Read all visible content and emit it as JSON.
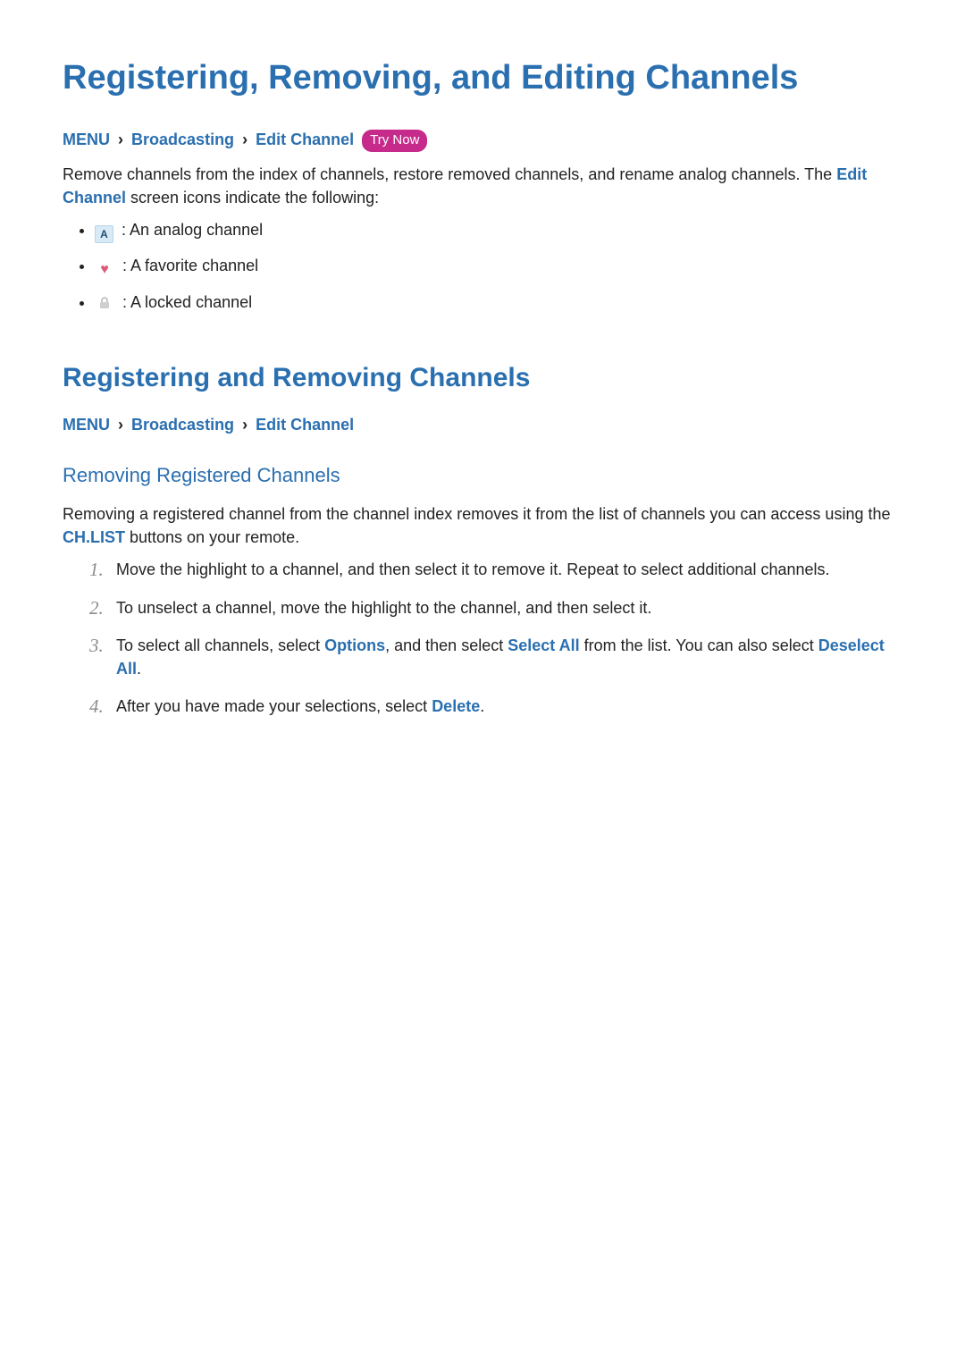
{
  "title": "Registering, Removing, and Editing Channels",
  "breadcrumb1": {
    "menu": "MENU",
    "broadcasting": "Broadcasting",
    "edit_channel": "Edit Channel",
    "try_now": "Try Now"
  },
  "intro": {
    "line1": "Remove channels from the index of channels, restore removed channels, and rename analog channels. The ",
    "edit_channel": "Edit Channel",
    "line2": " screen icons indicate the following:"
  },
  "icons": {
    "analog_letter": "A",
    "analog_label": " : An analog channel",
    "heart_label": " : A favorite channel",
    "lock_label": " : A locked channel"
  },
  "section2": {
    "heading": "Registering and Removing Channels",
    "breadcrumb": {
      "menu": "MENU",
      "broadcasting": "Broadcasting",
      "edit_channel": "Edit Channel"
    }
  },
  "subsection": {
    "heading": "Removing Registered Channels",
    "intro1": "Removing a registered channel from the channel index removes it from the list of channels you can access using the ",
    "chlist": "CH.LIST",
    "intro2": " buttons on your remote."
  },
  "steps": {
    "s1": "Move the highlight to a channel, and then select it to remove it. Repeat to select additional channels.",
    "s2": "To unselect a channel, move the highlight to the channel, and then select it.",
    "s3_a": "To select all channels, select ",
    "s3_options": "Options",
    "s3_b": ", and then select ",
    "s3_selectall": "Select All",
    "s3_c": " from the list. You can also select ",
    "s3_deselectall": "Deselect All",
    "s3_d": ".",
    "s4_a": "After you have made your selections, select ",
    "s4_delete": "Delete",
    "s4_b": "."
  }
}
